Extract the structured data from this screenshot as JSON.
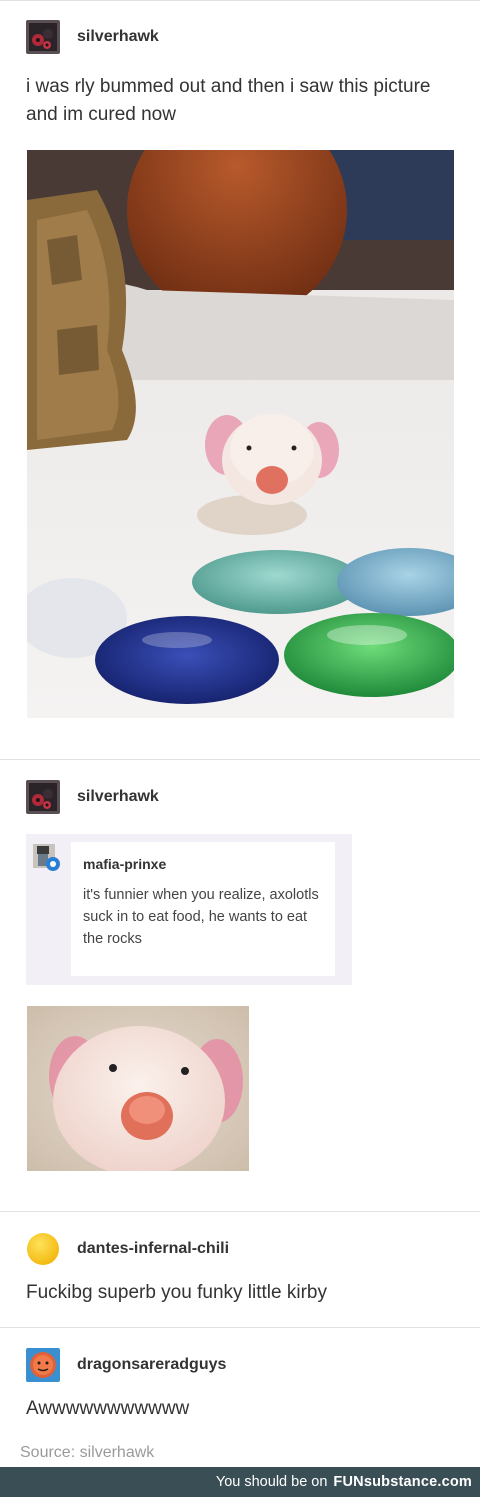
{
  "posts": [
    {
      "username": "silverhawk",
      "avatar": "dark-avatar-with-red-dots-icon",
      "text": "i was rly bummed out and then i saw this picture and im cured now",
      "image": "axolotl-in-aquarium-photo"
    },
    {
      "username": "silverhawk",
      "avatar": "dark-avatar-with-red-dots-icon",
      "quoted": {
        "username": "mafia-prinxe",
        "avatar": "small-character-avatar-icon",
        "text": "it's funnier when you realize, axolotls suck in to eat food, he wants to eat the rocks"
      },
      "image": "axolotl-closeup-photo"
    },
    {
      "username": "dantes-infernal-chili",
      "avatar": "yellow-circle-avatar-icon",
      "text": "Fuckibg superb you funky little kirby"
    },
    {
      "username": "dragonsareradguys",
      "avatar": "orange-face-avatar-icon",
      "text": "Awwwwwwwwwww"
    }
  ],
  "source": "Source: silverhawk",
  "footer": {
    "prefix": "You should be on",
    "brand": "FUNsubstance.com"
  },
  "colors": {
    "footer_bg": "#3a4e55",
    "reblog_bg": "#f3eff6",
    "divider": "#e2e2e2"
  }
}
